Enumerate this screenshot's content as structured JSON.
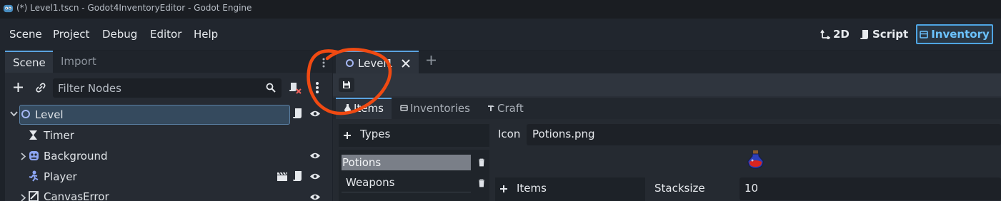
{
  "window": {
    "title": "(*) Level1.tscn - Godot4InventoryEditor - Godot Engine"
  },
  "menu": [
    "Scene",
    "Project",
    "Debug",
    "Editor",
    "Help"
  ],
  "workspaces": {
    "btn_2d": "2D",
    "btn_script": "Script",
    "btn_inventory": "Inventory"
  },
  "dock": {
    "tab_scene": "Scene",
    "tab_import": "Import",
    "filter_placeholder": "Filter Nodes"
  },
  "tree": [
    {
      "label": "Level",
      "icon": "node2d-circle-icon",
      "selected": true
    },
    {
      "label": "Timer",
      "icon": "hourglass-icon"
    },
    {
      "label": "Background",
      "icon": "sprite-icon"
    },
    {
      "label": "Player",
      "icon": "character-body-icon"
    },
    {
      "label": "CanvasError",
      "icon": "canvas-icon"
    }
  ],
  "scene_tab": {
    "label": "Level1",
    "add_tab": "+"
  },
  "inventory_tabs": [
    "Items",
    "Inventories",
    "Craft"
  ],
  "types": {
    "header": "Types",
    "items": [
      "Potions",
      "Weapons"
    ]
  },
  "properties": {
    "icon_label": "Icon",
    "icon_value": "Potions.png",
    "items_header": "Items",
    "stacksize_label": "Stacksize",
    "stacksize_value": "10"
  },
  "colors": {
    "accent": "#5ba3e0",
    "annotation": "#f04a12",
    "inventory_active": "#6cc3ff"
  }
}
